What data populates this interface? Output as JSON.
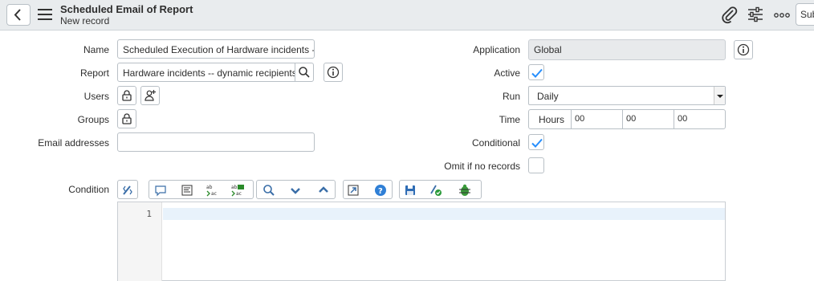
{
  "header": {
    "title": "Scheduled Email of Report",
    "subtitle": "New record",
    "submit_label": "Submit"
  },
  "form": {
    "name_label": "Name",
    "name_value": "Scheduled Execution of Hardware incidents -- dynamic recipients",
    "report_label": "Report",
    "report_value": "Hardware incidents -- dynamic recipients",
    "users_label": "Users",
    "groups_label": "Groups",
    "email_label": "Email addresses",
    "email_value": "",
    "condition_label": "Condition",
    "application_label": "Application",
    "application_value": "Global",
    "active_label": "Active",
    "active_checked": true,
    "run_label": "Run",
    "run_value": "Daily",
    "time_label": "Time",
    "time_hours_label": "Hours",
    "time_hh": "00",
    "time_mm": "00",
    "time_ss": "00",
    "conditional_label": "Conditional",
    "conditional_checked": true,
    "omit_label": "Omit if no records",
    "omit_checked": false
  },
  "editor": {
    "line_number": "1"
  },
  "colors": {
    "accent": "#278efc",
    "header_bg": "#e9ecee",
    "border": "#b9c0c6"
  }
}
